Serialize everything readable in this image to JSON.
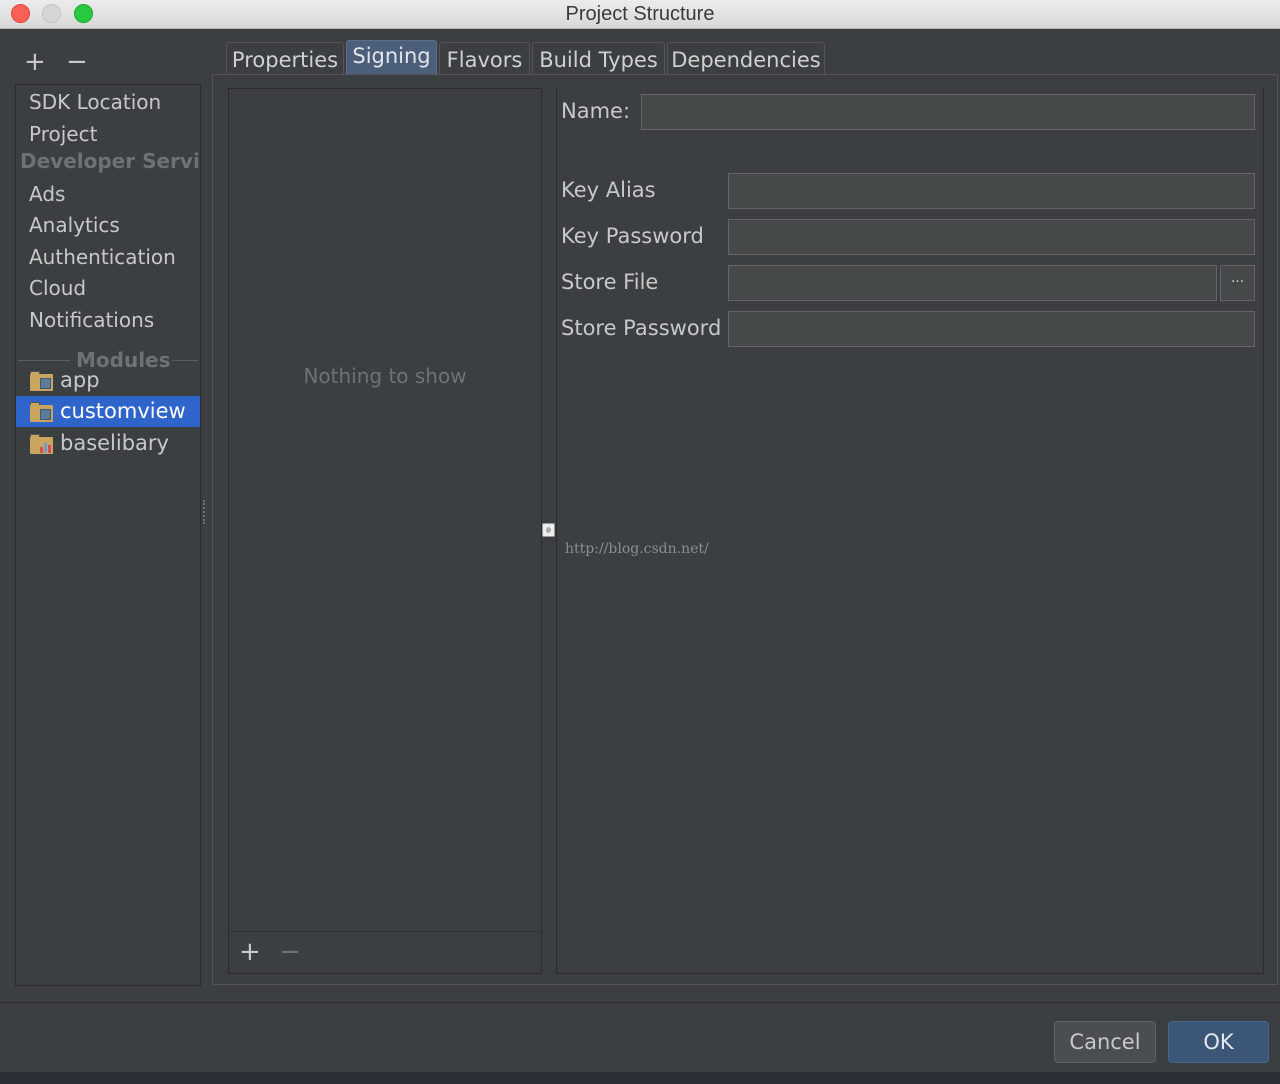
{
  "window": {
    "title": "Project Structure"
  },
  "sidebar": {
    "toolbar": {
      "add": "+",
      "remove": "−"
    },
    "items": [
      "SDK Location",
      "Project"
    ],
    "developer_services_header": "Developer Servic",
    "service_items": [
      "Ads",
      "Analytics",
      "Authentication",
      "Cloud",
      "Notifications"
    ],
    "modules_header": "Modules",
    "modules": [
      {
        "label": "app",
        "icon": "android-app-module-icon",
        "selected": false
      },
      {
        "label": "customview",
        "icon": "android-app-module-icon",
        "selected": true
      },
      {
        "label": "baselibary",
        "icon": "android-library-module-icon",
        "selected": false
      }
    ]
  },
  "tabs": [
    {
      "label": "Properties",
      "active": false
    },
    {
      "label": "Signing",
      "active": true
    },
    {
      "label": "Flavors",
      "active": false
    },
    {
      "label": "Build Types",
      "active": false
    },
    {
      "label": "Dependencies",
      "active": false
    }
  ],
  "signing_list": {
    "empty_text": "Nothing to show",
    "toolbar": {
      "add": "+",
      "remove": "−"
    }
  },
  "form": {
    "name_label": "Name:",
    "name_value": "",
    "key_alias_label": "Key Alias",
    "key_alias_value": "",
    "key_password_label": "Key Password",
    "key_password_value": "",
    "store_file_label": "Store File",
    "store_file_value": "",
    "store_file_browse": "···",
    "store_password_label": "Store Password",
    "store_password_value": ""
  },
  "watermark": "http://blog.csdn.net/",
  "buttons": {
    "cancel": "Cancel",
    "ok": "OK"
  },
  "colors": {
    "background": "#3c3f41",
    "selection": "#2f65ca",
    "active_tab": "#4c5f7a",
    "ok_button": "#3b5677"
  }
}
